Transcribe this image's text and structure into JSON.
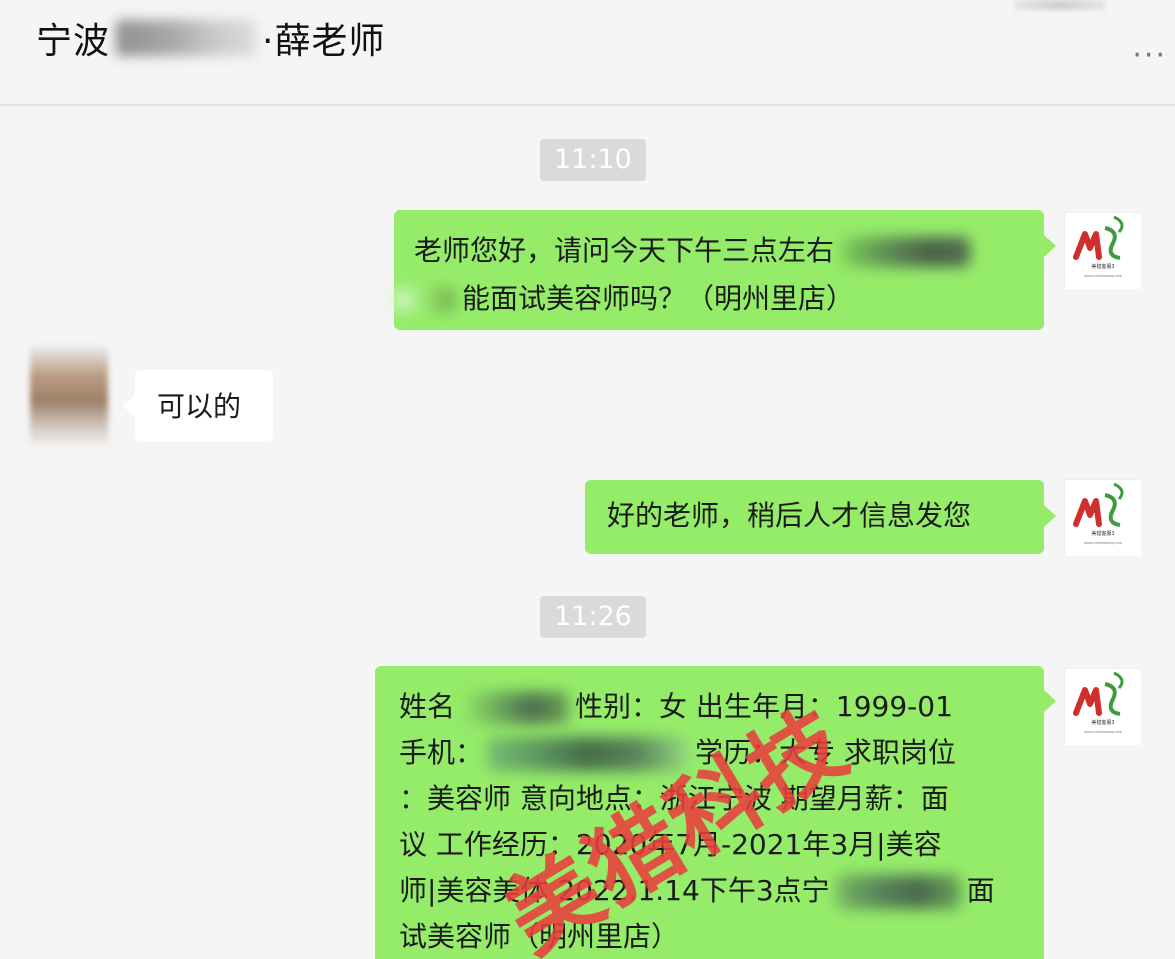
{
  "header": {
    "title_prefix": "宁波",
    "title_suffix": "·薛老师",
    "more_label": "···"
  },
  "messages": [
    {
      "type": "time",
      "text": "11:10"
    },
    {
      "type": "out",
      "parts": [
        "老师您好，请问今天下午三点左右",
        "能面试美容师吗？（明州里店）"
      ]
    },
    {
      "type": "in",
      "text": "可以的"
    },
    {
      "type": "out",
      "text": "好的老师，稍后人才信息发您"
    },
    {
      "type": "time",
      "text": "11:26"
    },
    {
      "type": "out",
      "lines": [
        "姓名",
        "性别：女 出生年月：1999-01",
        "手机：",
        "学历：大专 求职岗位",
        "：美容师 意向地点：浙江宁波 期望月薪：面",
        "议 工作经历：2020年7月-2021年3月|美容",
        "师|美容美体 2022.1.14下午3点宁",
        "面",
        "试美容师（明州里店）"
      ]
    }
  ],
  "watermark": "美猎科技",
  "colors": {
    "out_bubble": "#95ec69",
    "in_bubble": "#ffffff",
    "background": "#f5f5f5",
    "timestamp_bg": "#dadada",
    "watermark": "#ea3e3e"
  },
  "icons": {
    "me_avatar": "meilie-logo",
    "other_avatar": "blurred-person-photo",
    "more": "more-dots-icon"
  }
}
